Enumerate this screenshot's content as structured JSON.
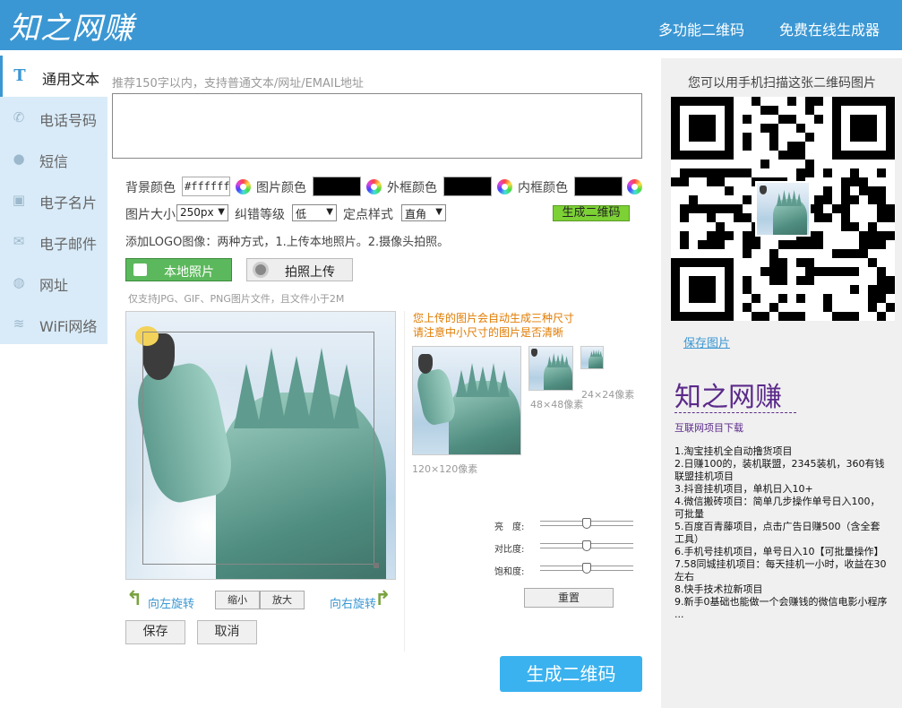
{
  "header": {
    "logo": "知之网赚",
    "nav": [
      "多功能二维码",
      "免费在线生成器"
    ]
  },
  "sidebar": {
    "items": [
      {
        "label": "通用文本",
        "icon": "text-icon",
        "active": true
      },
      {
        "label": "电话号码",
        "icon": "phone-icon"
      },
      {
        "label": "短信",
        "icon": "sms-icon"
      },
      {
        "label": "电子名片",
        "icon": "card-icon"
      },
      {
        "label": "电子邮件",
        "icon": "mail-icon"
      },
      {
        "label": "网址",
        "icon": "globe-icon"
      },
      {
        "label": "WiFi网络",
        "icon": "wifi-icon"
      }
    ]
  },
  "form": {
    "hint": "推荐150字以内，支持普通文本/网址/EMAIL地址",
    "bg_color_label": "背景颜色",
    "bg_color_value": "#ffffff",
    "img_color_label": "图片颜色",
    "img_color": "#000000",
    "outer_label": "外框颜色",
    "outer_color": "#000000",
    "inner_label": "内框颜色",
    "inner_color": "#000000",
    "size_label": "图片大小",
    "size_value": "250px",
    "ecc_label": "纠错等级",
    "ecc_value": "低",
    "style_label": "定点样式",
    "style_value": "直角",
    "gen_small": "生成二维码"
  },
  "logo": {
    "note": "添加LOGO图像：两种方式，1.上传本地照片。2.摄像头拍照。",
    "upload": "本地照片",
    "camera": "拍照上传",
    "support": "仅支持JPG、GIF、PNG图片文件，且文件小于2M",
    "preview_note1": "您上传的图片会自动生成三种尺寸",
    "preview_note2": "请注意中小尺寸的图片是否清晰",
    "size120": "120×120像素",
    "size48": "48×48像素",
    "size24": "24×24像素",
    "rotate_left": "向左旋转",
    "rotate_right": "向右旋转",
    "zoom_out": "缩小",
    "zoom_in": "放大",
    "save": "保存",
    "cancel": "取消",
    "brightness": "亮　度:",
    "contrast": "对比度:",
    "saturation": "饱和度:",
    "reset": "重置",
    "brightness_level": 0.5,
    "contrast_level": 0.5,
    "saturation_level": 0.5
  },
  "generate": "生成二维码",
  "right": {
    "title": "您可以用手机扫描这张二维码图片",
    "save_image": "保存图片",
    "ad_logo": "知之网赚",
    "ad_sub": "互联网项目下载",
    "ad_items": [
      "1.淘宝挂机全自动撸货项目",
      "2.日赚100的，装机联盟，2345装机，360有钱联盟挂机项目",
      "3.抖音挂机项目，单机日入10+",
      "4.微信搬砖项目：简单几步操作单号日入100，可批量",
      "5.百度百青藤项目，点击广告日赚500（含全套工具）",
      "6.手机号挂机项目，单号日入10【可批量操作】",
      "7.58同城挂机项目：每天挂机一小时，收益在30左右",
      "8.快手技术拉新项目",
      "9.新手0基础也能做一个会赚钱的微信电影小程序",
      "..."
    ]
  },
  "colors": {
    "brand": "#3b97d3",
    "green": "#5cb85c",
    "gen": "#3ab2ef",
    "orange": "#e07b00",
    "purple": "#5b2a8a"
  }
}
